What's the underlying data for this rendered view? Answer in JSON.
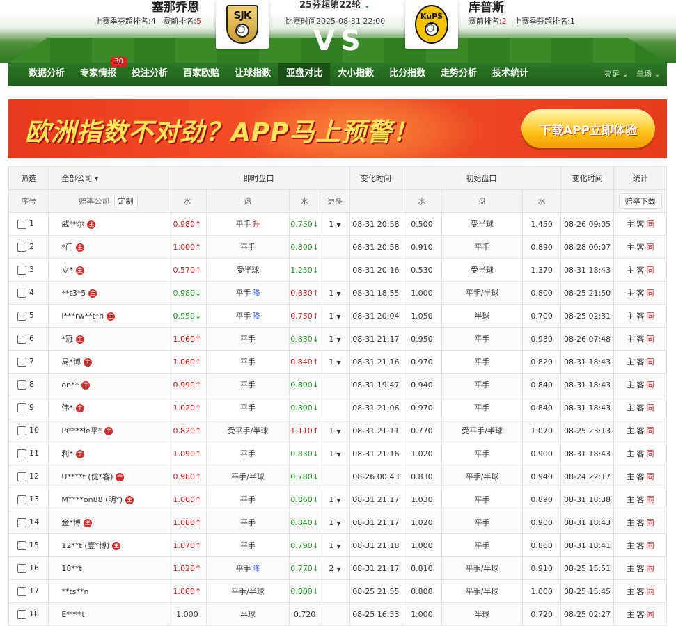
{
  "match": {
    "home_team": "塞那乔恩",
    "away_team": "库普斯",
    "home_last_rank_label": "上赛季芬超排名:4",
    "home_current_rank_label": "赛前排名:",
    "home_current_rank": "5",
    "away_current_rank_label": "赛前排名:",
    "away_current_rank": "2",
    "away_last_rank_label": "上赛季芬超排名:1",
    "league_round": "25芬超第22轮",
    "match_time": "比赛时间2025-08-31 22:00",
    "vs": "VS",
    "home_logo_text": "SJK",
    "away_logo_text": "KuPS"
  },
  "nav": {
    "items": [
      "数据分析",
      "专家情报",
      "投注分析",
      "百家欧赔",
      "让球指数",
      "亚盘对比",
      "大小指数",
      "比分指数",
      "走势分析",
      "技术统计"
    ],
    "badge": "30",
    "active_index": 5,
    "right_1": "亮足 ⌄",
    "right_2": "单场 ⌄"
  },
  "banner": {
    "slogan": "欧洲指数不对劲？APP马上预警！",
    "cta": "下载APP立即体验"
  },
  "table": {
    "head": {
      "filter": "筛选",
      "company_select": "全部公司",
      "live": "即时盘口",
      "change_time": "变化时间",
      "initial": "初始盘口",
      "change_time2": "变化时间",
      "stats": "统计"
    },
    "sub": {
      "index": "序号",
      "company": "赔率公司",
      "custom": "定制",
      "water1": "水",
      "line": "盘",
      "water2": "水",
      "more": "更多",
      "init_water1": "水",
      "init_line": "盘",
      "init_water2": "水",
      "download": "赔率下载"
    },
    "zhu": "主",
    "home_away": "主 客",
    "same": "同",
    "rows": [
      {
        "n": "1",
        "c": "威**尔",
        "z": true,
        "w1": "0.980",
        "a1": "↑",
        "d1": "up",
        "p": "平手",
        "chg": "升",
        "cd": "up",
        "w2": "0.750",
        "a2": "↓",
        "d2": "down",
        "m": "1",
        "t": "08-31 20:58",
        "iw1": "0.500",
        "ip": "受半球",
        "iw2": "1.450",
        "it": "08-26 09:05"
      },
      {
        "n": "2",
        "c": "*门",
        "z": true,
        "w1": "1.000",
        "a1": "↑",
        "d1": "up",
        "p": "平手",
        "chg": "",
        "cd": "",
        "w2": "0.800",
        "a2": "↓",
        "d2": "down",
        "m": "",
        "t": "08-31 20:58",
        "iw1": "0.910",
        "ip": "平手",
        "iw2": "0.890",
        "it": "08-28 00:07"
      },
      {
        "n": "3",
        "c": "立*",
        "z": true,
        "w1": "0.570",
        "a1": "↑",
        "d1": "up",
        "p": "受半球",
        "chg": "",
        "cd": "",
        "w2": "1.250",
        "a2": "↓",
        "d2": "down",
        "m": "",
        "t": "08-31 20:16",
        "iw1": "0.530",
        "ip": "受半球",
        "iw2": "1.370",
        "it": "08-31 18:43"
      },
      {
        "n": "4",
        "c": "**t3*5",
        "z": true,
        "w1": "0.980",
        "a1": "↓",
        "d1": "down",
        "p": "平手",
        "chg": "降",
        "cd": "down",
        "w2": "0.830",
        "a2": "↑",
        "d2": "up",
        "m": "1",
        "t": "08-31 18:55",
        "iw1": "1.000",
        "ip": "平手/半球",
        "iw2": "0.800",
        "it": "08-25 21:50"
      },
      {
        "n": "5",
        "c": "l***rw**t*n",
        "z": true,
        "w1": "0.950",
        "a1": "↓",
        "d1": "down",
        "p": "平手",
        "chg": "降",
        "cd": "down",
        "w2": "0.750",
        "a2": "↑",
        "d2": "up",
        "m": "1",
        "t": "08-31 20:04",
        "iw1": "1.050",
        "ip": "半球",
        "iw2": "0.700",
        "it": "08-25 02:31"
      },
      {
        "n": "6",
        "c": "*冠",
        "z": true,
        "w1": "1.060",
        "a1": "↑",
        "d1": "up",
        "p": "平手",
        "chg": "",
        "cd": "",
        "w2": "0.830",
        "a2": "↓",
        "d2": "down",
        "m": "1",
        "t": "08-31 21:17",
        "iw1": "0.950",
        "ip": "平手",
        "iw2": "0.930",
        "it": "08-26 07:48"
      },
      {
        "n": "7",
        "c": "易*博",
        "z": true,
        "w1": "1.060",
        "a1": "↑",
        "d1": "up",
        "p": "平手",
        "chg": "",
        "cd": "",
        "w2": "0.840",
        "a2": "↑",
        "d2": "up",
        "m": "1",
        "t": "08-31 21:16",
        "iw1": "0.970",
        "ip": "平手",
        "iw2": "0.820",
        "it": "08-31 18:43"
      },
      {
        "n": "8",
        "c": "on**",
        "z": true,
        "w1": "0.990",
        "a1": "↑",
        "d1": "up",
        "p": "平手",
        "chg": "",
        "cd": "",
        "w2": "0.800",
        "a2": "↓",
        "d2": "down",
        "m": "",
        "t": "08-31 19:47",
        "iw1": "0.940",
        "ip": "平手",
        "iw2": "0.840",
        "it": "08-31 18:43"
      },
      {
        "n": "9",
        "c": "伟*",
        "z": true,
        "w1": "1.020",
        "a1": "↑",
        "d1": "up",
        "p": "平手",
        "chg": "",
        "cd": "",
        "w2": "0.800",
        "a2": "↓",
        "d2": "down",
        "m": "",
        "t": "08-31 21:06",
        "iw1": "0.970",
        "ip": "平手",
        "iw2": "0.840",
        "it": "08-31 18:43"
      },
      {
        "n": "10",
        "c": "Pi****le平*",
        "z": true,
        "w1": "0.820",
        "a1": "↑",
        "d1": "up",
        "p": "受平手/半球",
        "chg": "",
        "cd": "",
        "w2": "1.110",
        "a2": "↑",
        "d2": "up",
        "m": "1",
        "t": "08-31 21:11",
        "iw1": "0.770",
        "ip": "受平手/半球",
        "iw2": "1.070",
        "it": "08-25 23:13"
      },
      {
        "n": "11",
        "c": "利*",
        "z": true,
        "w1": "1.090",
        "a1": "↑",
        "d1": "up",
        "p": "平手",
        "chg": "",
        "cd": "",
        "w2": "0.830",
        "a2": "↓",
        "d2": "down",
        "m": "1",
        "t": "08-31 21:16",
        "iw1": "1.020",
        "ip": "平手",
        "iw2": "0.900",
        "it": "08-31 18:43"
      },
      {
        "n": "12",
        "c": "U****t (优*客)",
        "z": true,
        "w1": "0.980",
        "a1": "↑",
        "d1": "up",
        "p": "平手/半球",
        "chg": "",
        "cd": "",
        "w2": "0.780",
        "a2": "↓",
        "d2": "down",
        "m": "",
        "t": "08-26 00:43",
        "iw1": "0.830",
        "ip": "平手/半球",
        "iw2": "0.940",
        "it": "08-24 22:17"
      },
      {
        "n": "13",
        "c": "M****on88 (明*)",
        "z": true,
        "w1": "1.060",
        "a1": "↑",
        "d1": "up",
        "p": "平手",
        "chg": "",
        "cd": "",
        "w2": "0.860",
        "a2": "↓",
        "d2": "down",
        "m": "1",
        "t": "08-31 21:17",
        "iw1": "1.030",
        "ip": "平手",
        "iw2": "0.890",
        "it": "08-31 18:38"
      },
      {
        "n": "14",
        "c": "金*博",
        "z": true,
        "w1": "1.080",
        "a1": "↑",
        "d1": "up",
        "p": "平手",
        "chg": "",
        "cd": "",
        "w2": "0.840",
        "a2": "↓",
        "d2": "down",
        "m": "1",
        "t": "08-31 21:17",
        "iw1": "1.020",
        "ip": "平手",
        "iw2": "0.900",
        "it": "08-31 18:43"
      },
      {
        "n": "15",
        "c": "12**t (壹*博)",
        "z": true,
        "w1": "1.070",
        "a1": "↑",
        "d1": "up",
        "p": "平手",
        "chg": "",
        "cd": "",
        "w2": "0.790",
        "a2": "↓",
        "d2": "down",
        "m": "1",
        "t": "08-31 21:18",
        "iw1": "1.000",
        "ip": "平手",
        "iw2": "0.860",
        "it": "08-31 18:41"
      },
      {
        "n": "16",
        "c": "18**t",
        "z": false,
        "w1": "1.020",
        "a1": "↑",
        "d1": "up",
        "p": "平手",
        "chg": "降",
        "cd": "down",
        "w2": "0.770",
        "a2": "↓",
        "d2": "down",
        "m": "2",
        "t": "08-31 21:17",
        "iw1": "0.810",
        "ip": "平手/半球",
        "iw2": "0.910",
        "it": "08-25 15:51"
      },
      {
        "n": "17",
        "c": "**ts**n",
        "z": false,
        "w1": "1.000",
        "a1": "↑",
        "d1": "up",
        "p": "平手/半球",
        "chg": "",
        "cd": "",
        "w2": "0.800",
        "a2": "↓",
        "d2": "down",
        "m": "",
        "t": "08-25 21:55",
        "iw1": "0.800",
        "ip": "平手/半球",
        "iw2": "1.000",
        "it": "08-25 15:45"
      },
      {
        "n": "18",
        "c": "E****t",
        "z": false,
        "w1": "1.000",
        "a1": "",
        "d1": "",
        "p": "半球",
        "chg": "",
        "cd": "",
        "w2": "0.720",
        "a2": "",
        "d2": "",
        "m": "",
        "t": "08-25 16:53",
        "iw1": "1.000",
        "ip": "半球",
        "iw2": "0.720",
        "it": "08-25 02:27"
      }
    ]
  }
}
